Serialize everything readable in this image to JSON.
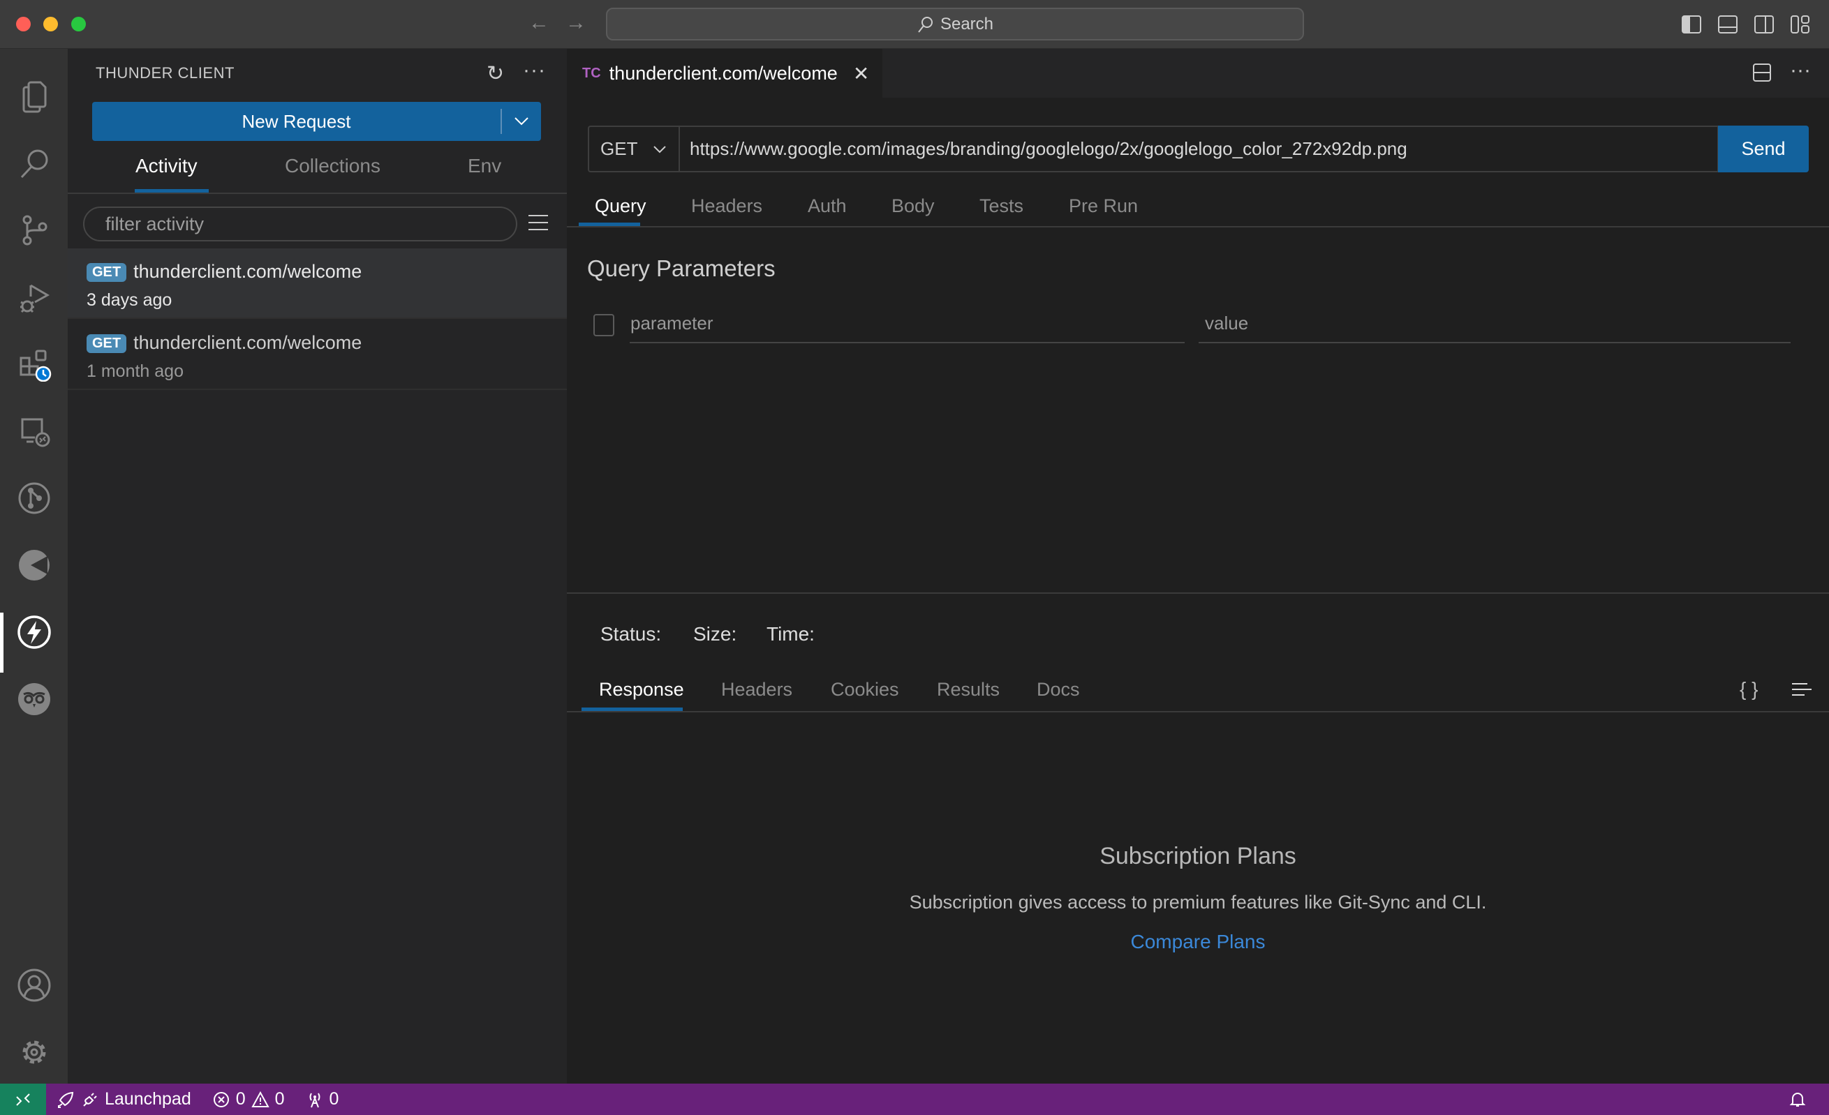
{
  "titlebar": {
    "search_label": "Search",
    "icons": [
      "back-arrow-icon",
      "forward-arrow-icon",
      "toggle-primary-sidebar-icon",
      "toggle-panel-icon",
      "toggle-secondary-sidebar-icon",
      "customize-layout-icon"
    ]
  },
  "activity_bar": {
    "items": [
      "explorer",
      "search",
      "source-control",
      "run-and-debug",
      "extensions",
      "remote-explorer",
      "git-graph",
      "codetime",
      "thunder-client",
      "owl"
    ],
    "bottom": [
      "accounts",
      "manage"
    ],
    "active": "thunder-client"
  },
  "sidebar": {
    "title": "THUNDER CLIENT",
    "new_request_label": "New Request",
    "tabs": [
      {
        "label": "Activity",
        "active": true
      },
      {
        "label": "Collections",
        "active": false
      },
      {
        "label": "Env",
        "active": false
      }
    ],
    "filter_placeholder": "filter activity",
    "history": [
      {
        "method": "GET",
        "url": "thunderclient.com/welcome",
        "time": "3 days ago",
        "selected": true
      },
      {
        "method": "GET",
        "url": "thunderclient.com/welcome",
        "time": "1 month ago",
        "selected": false
      }
    ]
  },
  "editor": {
    "tab": {
      "icon_text": "TC",
      "title": "thunderclient.com/welcome"
    },
    "method": "GET",
    "url": "https://www.google.com/images/branding/googlelogo/2x/googlelogo_color_272x92dp.png",
    "send_label": "Send",
    "request_tabs": [
      {
        "label": "Query",
        "active": true
      },
      {
        "label": "Headers",
        "active": false
      },
      {
        "label": "Auth",
        "active": false
      },
      {
        "label": "Body",
        "active": false
      },
      {
        "label": "Tests",
        "active": false
      },
      {
        "label": "Pre Run",
        "active": false
      }
    ],
    "query_title": "Query Parameters",
    "param_placeholder": "parameter",
    "value_placeholder": "value",
    "status_labels": {
      "status": "Status:",
      "size": "Size:",
      "time": "Time:"
    },
    "response_tabs": [
      {
        "label": "Response",
        "active": true
      },
      {
        "label": "Headers",
        "active": false
      },
      {
        "label": "Cookies",
        "active": false
      },
      {
        "label": "Results",
        "active": false
      },
      {
        "label": "Docs",
        "active": false
      }
    ],
    "json_format_label": "{ }",
    "subscription": {
      "title": "Subscription Plans",
      "text": "Subscription gives access to premium features like Git-Sync and CLI.",
      "link": "Compare Plans"
    }
  },
  "statusbar": {
    "launchpad": "Launchpad",
    "errors": "0",
    "warnings": "0",
    "ports": "0"
  },
  "colors": {
    "accent": "#13629d",
    "statusbar": "#68217a",
    "remote": "#16825d",
    "link": "#3b88d8",
    "badge": "#4a8ab4"
  }
}
